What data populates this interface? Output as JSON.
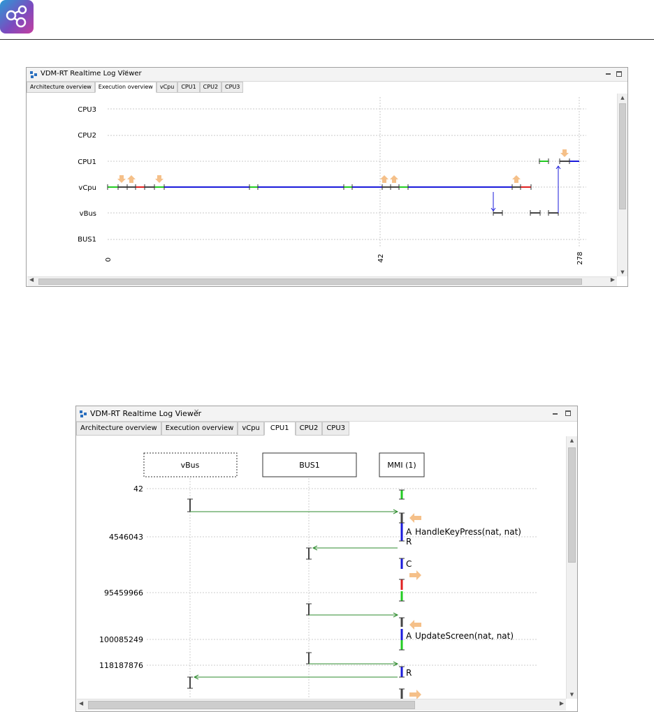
{
  "top_view": {
    "title": "VDM-RT Realtime Log Viewer",
    "tabs": [
      "Architecture overview",
      "Execution overview",
      "vCpu",
      "CPU1",
      "CPU2",
      "CPU3"
    ],
    "active_tab": "Execution overview",
    "rows": [
      "CPU3",
      "CPU2",
      "CPU1",
      "vCpu",
      "vBus",
      "BUS1"
    ],
    "x_ticks": [
      "0",
      "42",
      "278"
    ]
  },
  "bottom_view": {
    "title": "VDM-RT Realtime Log Viewer",
    "tabs": [
      "Architecture overview",
      "Execution overview",
      "vCpu",
      "CPU1",
      "CPU2",
      "CPU3"
    ],
    "active_tab": "CPU1",
    "lanes": [
      "vBus",
      "BUS1",
      "MMI (1)"
    ],
    "time_labels": [
      "42",
      "4546043",
      "95459966",
      "100085249",
      "118187876"
    ],
    "events": [
      {
        "letter": "A",
        "text": "HandleKeyPress(nat, nat)"
      },
      {
        "letter": "R",
        "text": ""
      },
      {
        "letter": "C",
        "text": ""
      },
      {
        "letter": "A",
        "text": "UpdateScreen(nat, nat)"
      },
      {
        "letter": "R",
        "text": ""
      }
    ]
  },
  "colors": {
    "blue": "#1a1adb",
    "green": "#22cc22",
    "red": "#e02020",
    "gray": "#444444",
    "orange_arrow": "#f5c089",
    "msg_arrow": "#2e8b2e"
  }
}
